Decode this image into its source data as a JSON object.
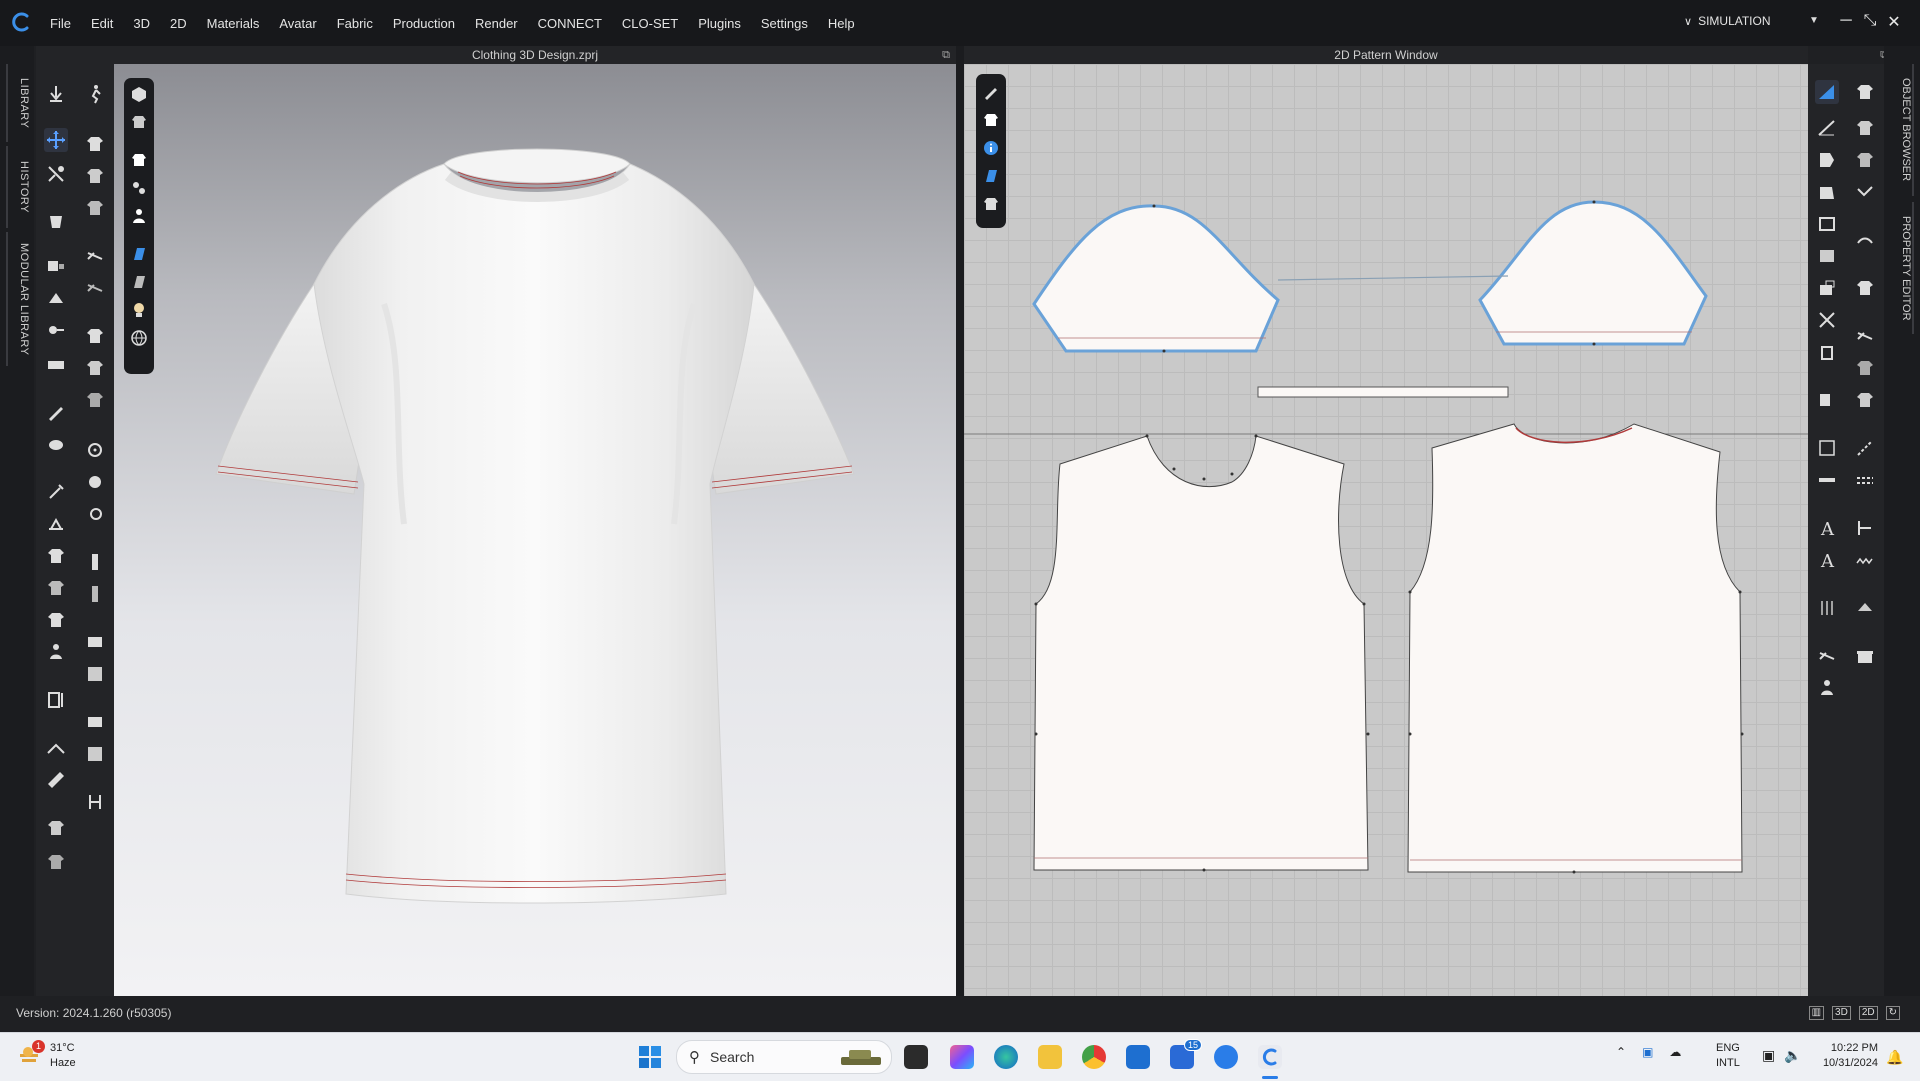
{
  "menu": [
    "File",
    "Edit",
    "3D",
    "2D",
    "Materials",
    "Avatar",
    "Fabric",
    "Production",
    "Render",
    "CONNECT",
    "CLO-SET",
    "Plugins",
    "Settings",
    "Help"
  ],
  "mode": {
    "label": "SIMULATION"
  },
  "window_controls": {
    "minimize": "─",
    "restore": "⤡",
    "close": "✕"
  },
  "left_tabs": [
    "LIBRARY",
    "HISTORY",
    "MODULAR LIBRARY"
  ],
  "right_tabs": [
    "OBJECT BROWSER",
    "PROPERTY EDITOR"
  ],
  "viewport_3d": {
    "title": "Clothing 3D Design.zprj"
  },
  "viewport_2d": {
    "title": "2D Pattern Window"
  },
  "status": {
    "version": "Version: 2024.1.260 (r50305)",
    "view_modes": [
      "▥",
      "3D",
      "2D",
      "↻"
    ]
  },
  "taskbar": {
    "weather": {
      "temp": "31°C",
      "condition": "Haze",
      "badge": "1"
    },
    "search_placeholder": "Search",
    "store_badge": "15",
    "lang_1": "ENG",
    "lang_2": "INTL",
    "time": "10:22 PM",
    "date": "10/31/2024"
  },
  "colors": {
    "accent": "#3b7fd9",
    "selection": "#6aa2d8",
    "stitch": "#b03a3a"
  }
}
